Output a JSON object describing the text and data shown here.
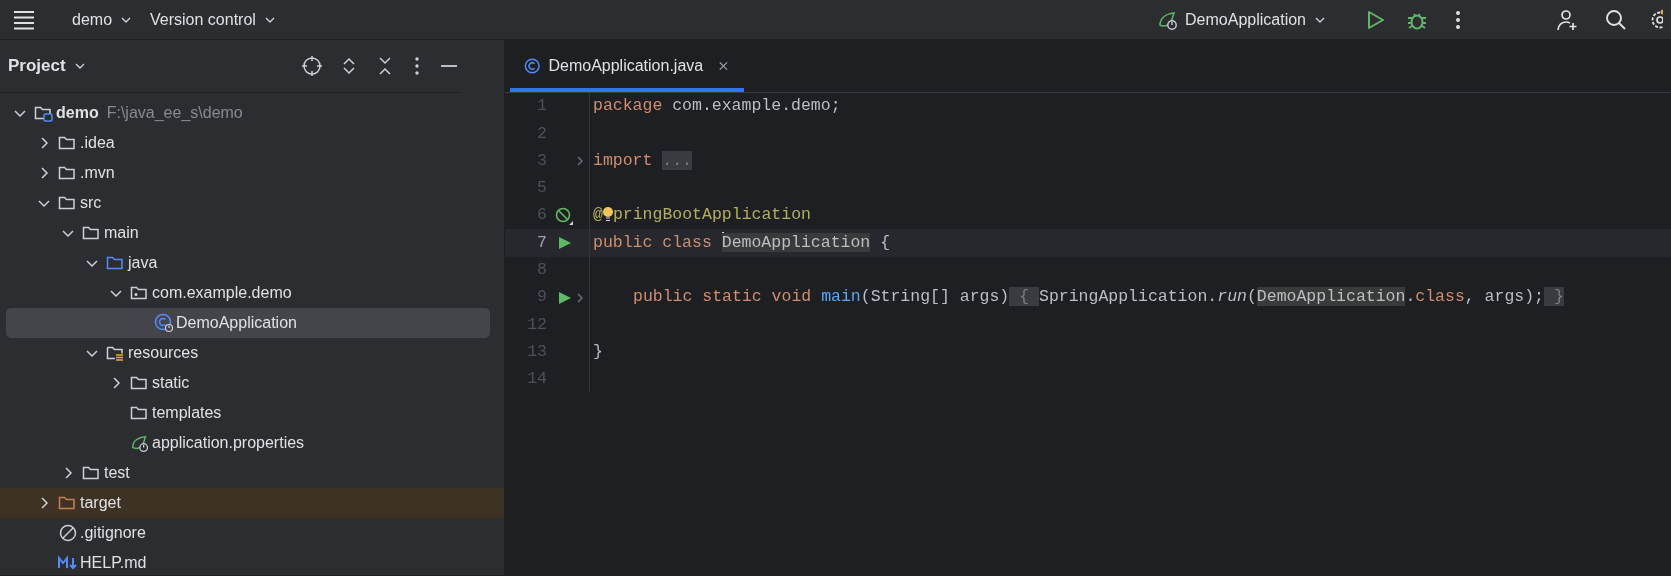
{
  "toolbar": {
    "project": "demo",
    "vcs": "Version control",
    "run_config": "DemoApplication"
  },
  "project_panel": {
    "title": "Project",
    "tree": [
      {
        "label": "demo",
        "path": "F:\\java_ee_s\\demo",
        "kind": "module",
        "expanded": true,
        "selected": false,
        "children": [
          {
            "label": ".idea",
            "kind": "folder",
            "expanded": false,
            "selected": false
          },
          {
            "label": ".mvn",
            "kind": "folder",
            "expanded": false,
            "selected": false
          },
          {
            "label": "src",
            "kind": "folder",
            "expanded": true,
            "selected": false,
            "children": [
              {
                "label": "main",
                "kind": "folder",
                "expanded": true,
                "selected": false,
                "children": [
                  {
                    "label": "java",
                    "kind": "source",
                    "expanded": true,
                    "selected": false,
                    "children": [
                      {
                        "label": "com.example.demo",
                        "kind": "package",
                        "expanded": true,
                        "selected": false,
                        "children": [
                          {
                            "label": "DemoApplication",
                            "kind": "class",
                            "selected": true
                          }
                        ]
                      }
                    ]
                  },
                  {
                    "label": "resources",
                    "kind": "resources",
                    "expanded": true,
                    "selected": false,
                    "children": [
                      {
                        "label": "static",
                        "kind": "folder",
                        "expanded": false,
                        "selected": false
                      },
                      {
                        "label": "templates",
                        "kind": "folder",
                        "selected": false
                      },
                      {
                        "label": "application.properties",
                        "kind": "spring",
                        "selected": false
                      }
                    ]
                  }
                ]
              },
              {
                "label": "test",
                "kind": "folder",
                "expanded": false,
                "selected": false
              }
            ]
          },
          {
            "label": "target",
            "kind": "excluded",
            "expanded": false,
            "selected": false
          },
          {
            "label": ".gitignore",
            "kind": "gitignore",
            "selected": false
          },
          {
            "label": "HELP.md",
            "kind": "markdown",
            "selected": false
          }
        ]
      }
    ]
  },
  "editor": {
    "tabs": [
      {
        "label": "DemoApplication.java",
        "selected": true
      }
    ],
    "lines": [
      {
        "number": "1",
        "current": false,
        "tokens": [
          {
            "kind": "kw",
            "text": "package"
          },
          {
            "kind": "plain",
            "text": " com.example.demo;"
          }
        ]
      },
      {
        "number": "2",
        "current": false
      },
      {
        "number": "3",
        "current": false,
        "foldable": true,
        "tokens": [
          {
            "kind": "kw",
            "text": "import"
          },
          {
            "kind": "fold",
            "text": "..."
          }
        ]
      },
      {
        "number": "5",
        "current": false
      },
      {
        "number": "6",
        "current": false,
        "gutter": {
          "kind": "spring"
        },
        "tokens": [
          {
            "kind": "ann",
            "text": "@",
            "intention": true
          },
          {
            "kind": "ann",
            "text": "pringBootApplication"
          }
        ]
      },
      {
        "number": "7",
        "current": true,
        "gutter": {
          "kind": "run"
        },
        "tokens": [
          {
            "kind": "kw",
            "text": "public class "
          },
          {
            "kind": "hl",
            "text": "DemoApplication",
            "caret": true
          },
          {
            "kind": "plain",
            "text": " {"
          }
        ]
      },
      {
        "number": "8",
        "current": false
      },
      {
        "number": "9",
        "current": false,
        "gutter": {
          "kind": "run"
        },
        "foldable": true,
        "indented": true,
        "tokens": [
          {
            "kind": "kw",
            "text": "public static void "
          },
          {
            "kind": "fn",
            "text": "main"
          },
          {
            "kind": "plain",
            "text": "(String[] args)"
          },
          {
            "kind": "fold",
            "text": " { "
          },
          {
            "kind": "plain",
            "text": "SpringApplication."
          },
          {
            "kind": "it",
            "text": "run"
          },
          {
            "kind": "plain",
            "text": "("
          },
          {
            "kind": "hl",
            "text": "DemoApplication"
          },
          {
            "kind": "plain",
            "text": "."
          },
          {
            "kind": "kw",
            "text": "class"
          },
          {
            "kind": "plain",
            "text": ", args);"
          },
          {
            "kind": "fold",
            "text": " }"
          }
        ]
      },
      {
        "number": "12",
        "current": false
      },
      {
        "number": "13",
        "current": false,
        "tokens": [
          {
            "kind": "plain",
            "text": "}"
          }
        ]
      },
      {
        "number": "14",
        "current": false
      }
    ]
  }
}
